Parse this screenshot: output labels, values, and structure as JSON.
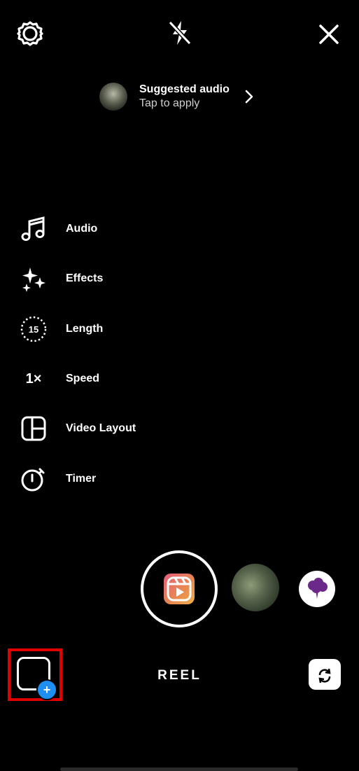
{
  "top_bar": {
    "settings_icon": "gear-icon",
    "flash_icon": "flash-off-icon",
    "close_icon": "close-icon"
  },
  "suggested_audio": {
    "title": "Suggested audio",
    "subtitle": "Tap to apply"
  },
  "side_menu": [
    {
      "label": "Audio",
      "icon": "music-note-icon"
    },
    {
      "label": "Effects",
      "icon": "sparkles-icon"
    },
    {
      "label": "Length",
      "icon": "length-timer-icon",
      "icon_text": "15"
    },
    {
      "label": "Speed",
      "icon": "speed-icon",
      "icon_text": "1×"
    },
    {
      "label": "Video Layout",
      "icon": "layout-icon"
    },
    {
      "label": "Timer",
      "icon": "stopwatch-icon"
    }
  ],
  "camera": {
    "mode_label": "REEL"
  },
  "colors": {
    "background": "#000000",
    "highlight": "#e00000",
    "plus_badge": "#1f8ef1"
  }
}
